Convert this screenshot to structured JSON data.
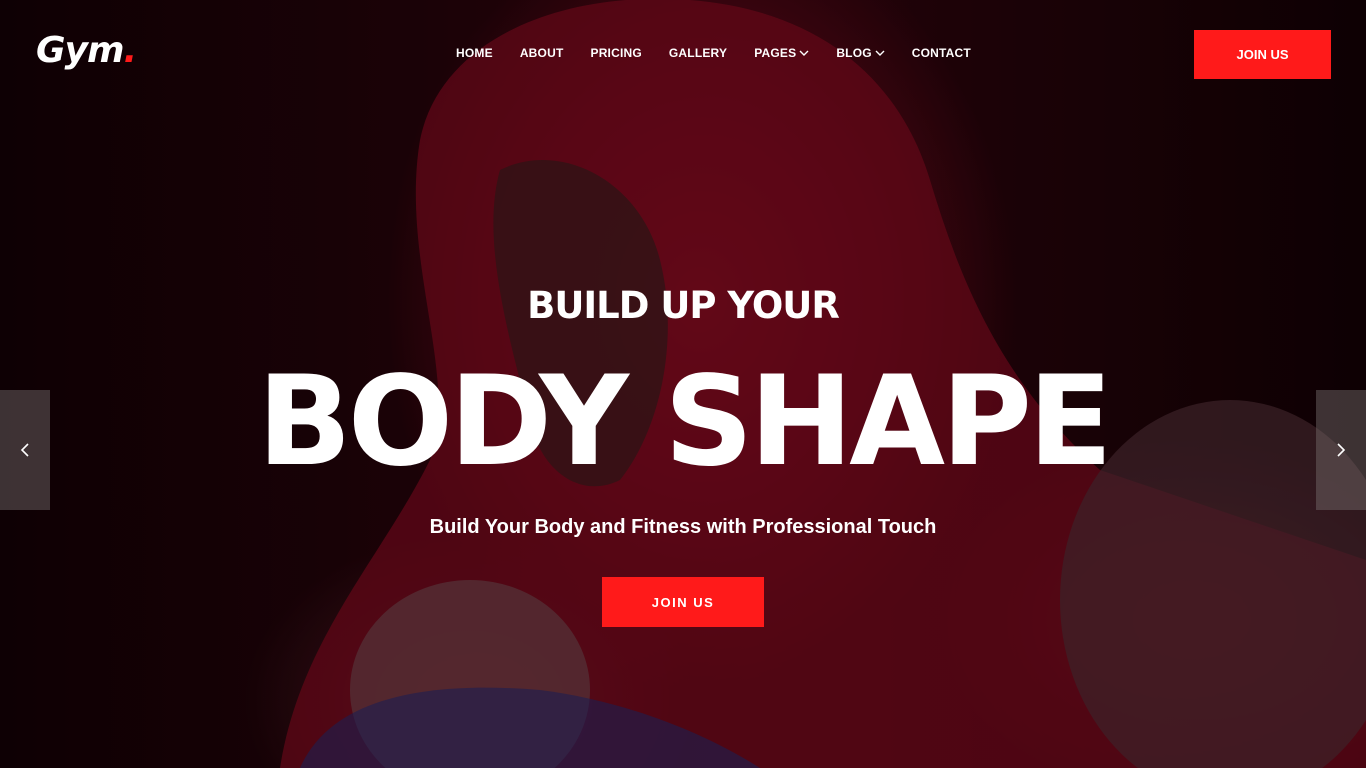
{
  "header": {
    "logo_text": "Gym",
    "logo_dot": ".",
    "nav": [
      {
        "label": "HOME",
        "dropdown": false
      },
      {
        "label": "ABOUT",
        "dropdown": false
      },
      {
        "label": "PRICING",
        "dropdown": false
      },
      {
        "label": "GALLERY",
        "dropdown": false
      },
      {
        "label": "PAGES",
        "dropdown": true
      },
      {
        "label": "BLOG",
        "dropdown": true
      },
      {
        "label": "CONTACT",
        "dropdown": false
      }
    ],
    "join_label": "JOIN US"
  },
  "hero": {
    "pre_title": "BUILD UP YOUR",
    "title": "BODY SHAPE",
    "subtitle": "Build Your Body and Fitness with Professional Touch",
    "cta_label": "JOIN US",
    "prev_icon": "chevron-left-icon",
    "next_icon": "chevron-right-icon"
  },
  "colors": {
    "accent": "#ff1a1a",
    "background": "#140205",
    "text": "#ffffff"
  }
}
